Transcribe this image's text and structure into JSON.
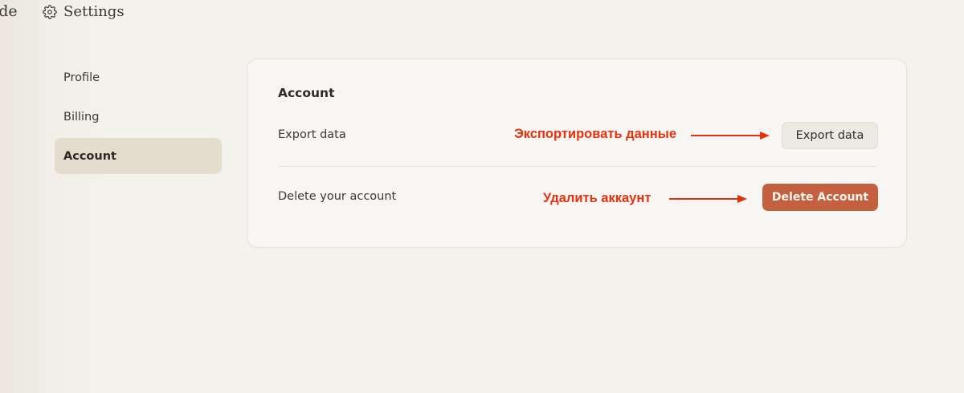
{
  "header": {
    "brand": "ude",
    "title": "Settings",
    "icon": "gear-icon"
  },
  "sidebar": {
    "items": [
      {
        "label": "Profile",
        "active": false
      },
      {
        "label": "Billing",
        "active": false
      },
      {
        "label": "Account",
        "active": true
      }
    ]
  },
  "account": {
    "title": "Account",
    "export_label": "Export data",
    "export_button": "Export data",
    "delete_label": "Delete your account",
    "delete_button": "Delete Account"
  },
  "annotations": {
    "export": "Экспортировать данные",
    "delete": "Удалить аккаунт",
    "color": "#e8300f"
  },
  "colors": {
    "accent": "#c2603f",
    "active_nav": "#e3ddcd"
  }
}
